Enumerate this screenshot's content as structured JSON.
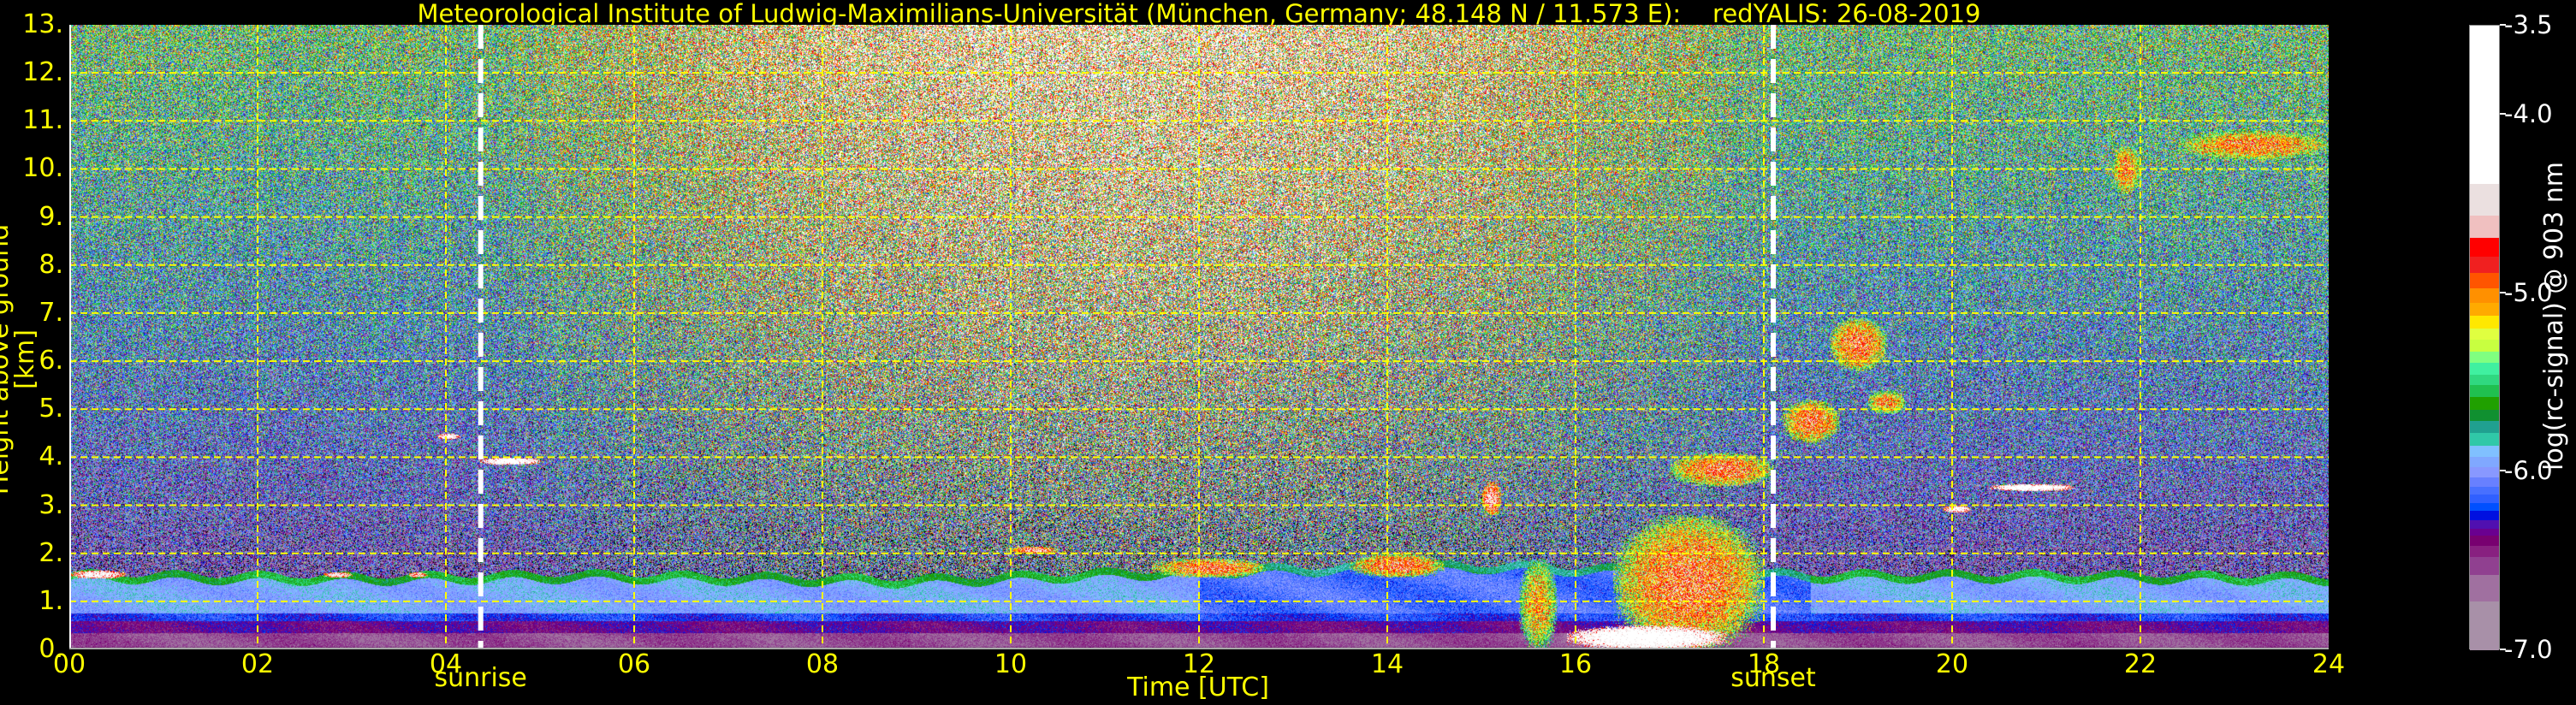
{
  "chart_data": {
    "type": "heatmap",
    "title": "Meteorological Institute of Ludwig-Maximilians-Universität (München, Germany; 48.148 N / 11.573 E):    redYALIS: 26-08-2019",
    "xlabel": "Time [UTC]",
    "ylabel": "Height above ground [km]",
    "xlim": [
      0,
      24
    ],
    "ylim": [
      0,
      13
    ],
    "xticks": [
      0,
      2,
      4,
      6,
      8,
      10,
      12,
      14,
      16,
      18,
      20,
      22,
      24
    ],
    "xtick_labels": [
      "00",
      "02",
      "04",
      "06",
      "08",
      "10",
      "12",
      "14",
      "16",
      "18",
      "20",
      "22",
      "24"
    ],
    "yticks": [
      0,
      1,
      2,
      3,
      4,
      5,
      6,
      7,
      8,
      9,
      10,
      11,
      12,
      13
    ],
    "ytick_labels": [
      "0.",
      "1.",
      "2.",
      "3.",
      "4.",
      "5.",
      "6.",
      "7.",
      "8.",
      "9.",
      "10.",
      "11.",
      "12.",
      "13."
    ],
    "grid": true,
    "annotations": [
      {
        "label": "sunrise",
        "time": 4.37
      },
      {
        "label": "sunset",
        "time": 18.1
      }
    ],
    "colorbar": {
      "label": "log(rc-signal) @ 903 nm",
      "range": [
        -7.0,
        -3.5
      ],
      "ticks": [
        -3.5,
        -4.0,
        -5.0,
        -6.0,
        -7.0
      ],
      "tick_labels": [
        "-3.5",
        "-4.0",
        "-5.0",
        "-6.0",
        "-7.0"
      ],
      "bounds": [
        -7.0,
        -6.722,
        -6.576,
        -6.475,
        -6.412,
        -6.354,
        -6.316,
        -6.269,
        -6.218,
        -6.173,
        -6.127,
        -6.084,
        -6.029,
        -5.971,
        -5.913,
        -5.852,
        -5.782,
        -5.711,
        -5.651,
        -5.58,
        -5.512,
        -5.454,
        -5.386,
        -5.323,
        -5.257,
        -5.194,
        -5.121,
        -5.051,
        -4.97,
        -4.882,
        -4.793,
        -4.685,
        -4.564,
        -4.383,
        -3.5
      ],
      "colors": [
        "#a890a8",
        "#a070a0",
        "#904090",
        "#882080",
        "#780070",
        "#6a0090",
        "#5010b0",
        "#0010e0",
        "#0050ff",
        "#3060ff",
        "#4870ff",
        "#6880ff",
        "#8898ff",
        "#80a8ff",
        "#80c0ff",
        "#30c8a8",
        "#20a090",
        "#109030",
        "#20a000",
        "#20c050",
        "#30d880",
        "#40f0a0",
        "#80ff80",
        "#c8ff40",
        "#e0ff40",
        "#ffe800",
        "#ffaa00",
        "#ff9000",
        "#ff5500",
        "#f02020",
        "#ff0000",
        "#f0c0c0",
        "#ebe0e0",
        "#ffffff"
      ]
    },
    "boundary_layer_top_km": {
      "times": [
        0,
        3,
        5.5,
        9,
        12,
        15,
        18.5,
        21,
        24
      ],
      "heights": [
        1.6,
        1.55,
        1.6,
        1.5,
        1.7,
        1.8,
        1.6,
        1.6,
        1.55
      ]
    },
    "features": [
      {
        "name": "night-layer-top",
        "t0": 0.0,
        "t1": 0.6,
        "h0": 1.48,
        "h1": 1.65,
        "value": -4.2
      },
      {
        "name": "night-layer-top",
        "t0": 2.7,
        "t1": 3.0,
        "h0": 1.5,
        "h1": 1.62,
        "value": -4.3
      },
      {
        "name": "night-layer-top",
        "t0": 3.6,
        "t1": 3.8,
        "h0": 1.5,
        "h1": 1.62,
        "value": -4.4
      },
      {
        "name": "cloud",
        "t0": 3.9,
        "t1": 4.15,
        "h0": 4.38,
        "h1": 4.5,
        "value": -4.1
      },
      {
        "name": "cloud",
        "t0": 4.35,
        "t1": 5.0,
        "h0": 3.85,
        "h1": 4.0,
        "value": -4.0
      },
      {
        "name": "cloud",
        "t0": 10.0,
        "t1": 10.5,
        "h0": 2.0,
        "h1": 2.15,
        "value": -4.6
      },
      {
        "name": "cumulus",
        "t0": 11.5,
        "t1": 12.7,
        "h0": 1.5,
        "h1": 1.9,
        "value": -4.8
      },
      {
        "name": "cumulus",
        "t0": 13.6,
        "t1": 14.6,
        "h0": 1.5,
        "h1": 2.0,
        "value": -4.8
      },
      {
        "name": "cumulus",
        "t0": 15.0,
        "t1": 15.2,
        "h0": 2.8,
        "h1": 3.5,
        "value": -4.5
      },
      {
        "name": "rain",
        "t0": 15.4,
        "t1": 15.8,
        "h0": 0.0,
        "h1": 1.9,
        "value": -5.0
      },
      {
        "name": "rain",
        "t0": 16.4,
        "t1": 18.0,
        "h0": 0.0,
        "h1": 2.8,
        "value": -4.8
      },
      {
        "name": "rain-core",
        "t0": 15.9,
        "t1": 17.6,
        "h0": 0.0,
        "h1": 0.5,
        "value": -3.9
      },
      {
        "name": "cloud",
        "t0": 17.0,
        "t1": 18.1,
        "h0": 3.4,
        "h1": 4.1,
        "value": -4.8
      },
      {
        "name": "cloud",
        "t0": 18.2,
        "t1": 18.8,
        "h0": 4.3,
        "h1": 5.2,
        "value": -4.8
      },
      {
        "name": "cloud",
        "t0": 18.7,
        "t1": 19.3,
        "h0": 5.8,
        "h1": 6.9,
        "value": -4.8
      },
      {
        "name": "cloud",
        "t0": 19.1,
        "t1": 19.5,
        "h0": 4.9,
        "h1": 5.4,
        "value": -4.9
      },
      {
        "name": "cloud",
        "t0": 19.9,
        "t1": 20.2,
        "h0": 2.85,
        "h1": 3.0,
        "value": -4.2
      },
      {
        "name": "cloud",
        "t0": 20.4,
        "t1": 21.3,
        "h0": 3.3,
        "h1": 3.45,
        "value": -4.0
      },
      {
        "name": "cirrus",
        "t0": 21.7,
        "t1": 22.0,
        "h0": 9.5,
        "h1": 10.5,
        "value": -4.9
      },
      {
        "name": "cirrus",
        "t0": 22.4,
        "t1": 24.0,
        "h0": 10.2,
        "h1": 10.8,
        "value": -4.9
      }
    ]
  }
}
